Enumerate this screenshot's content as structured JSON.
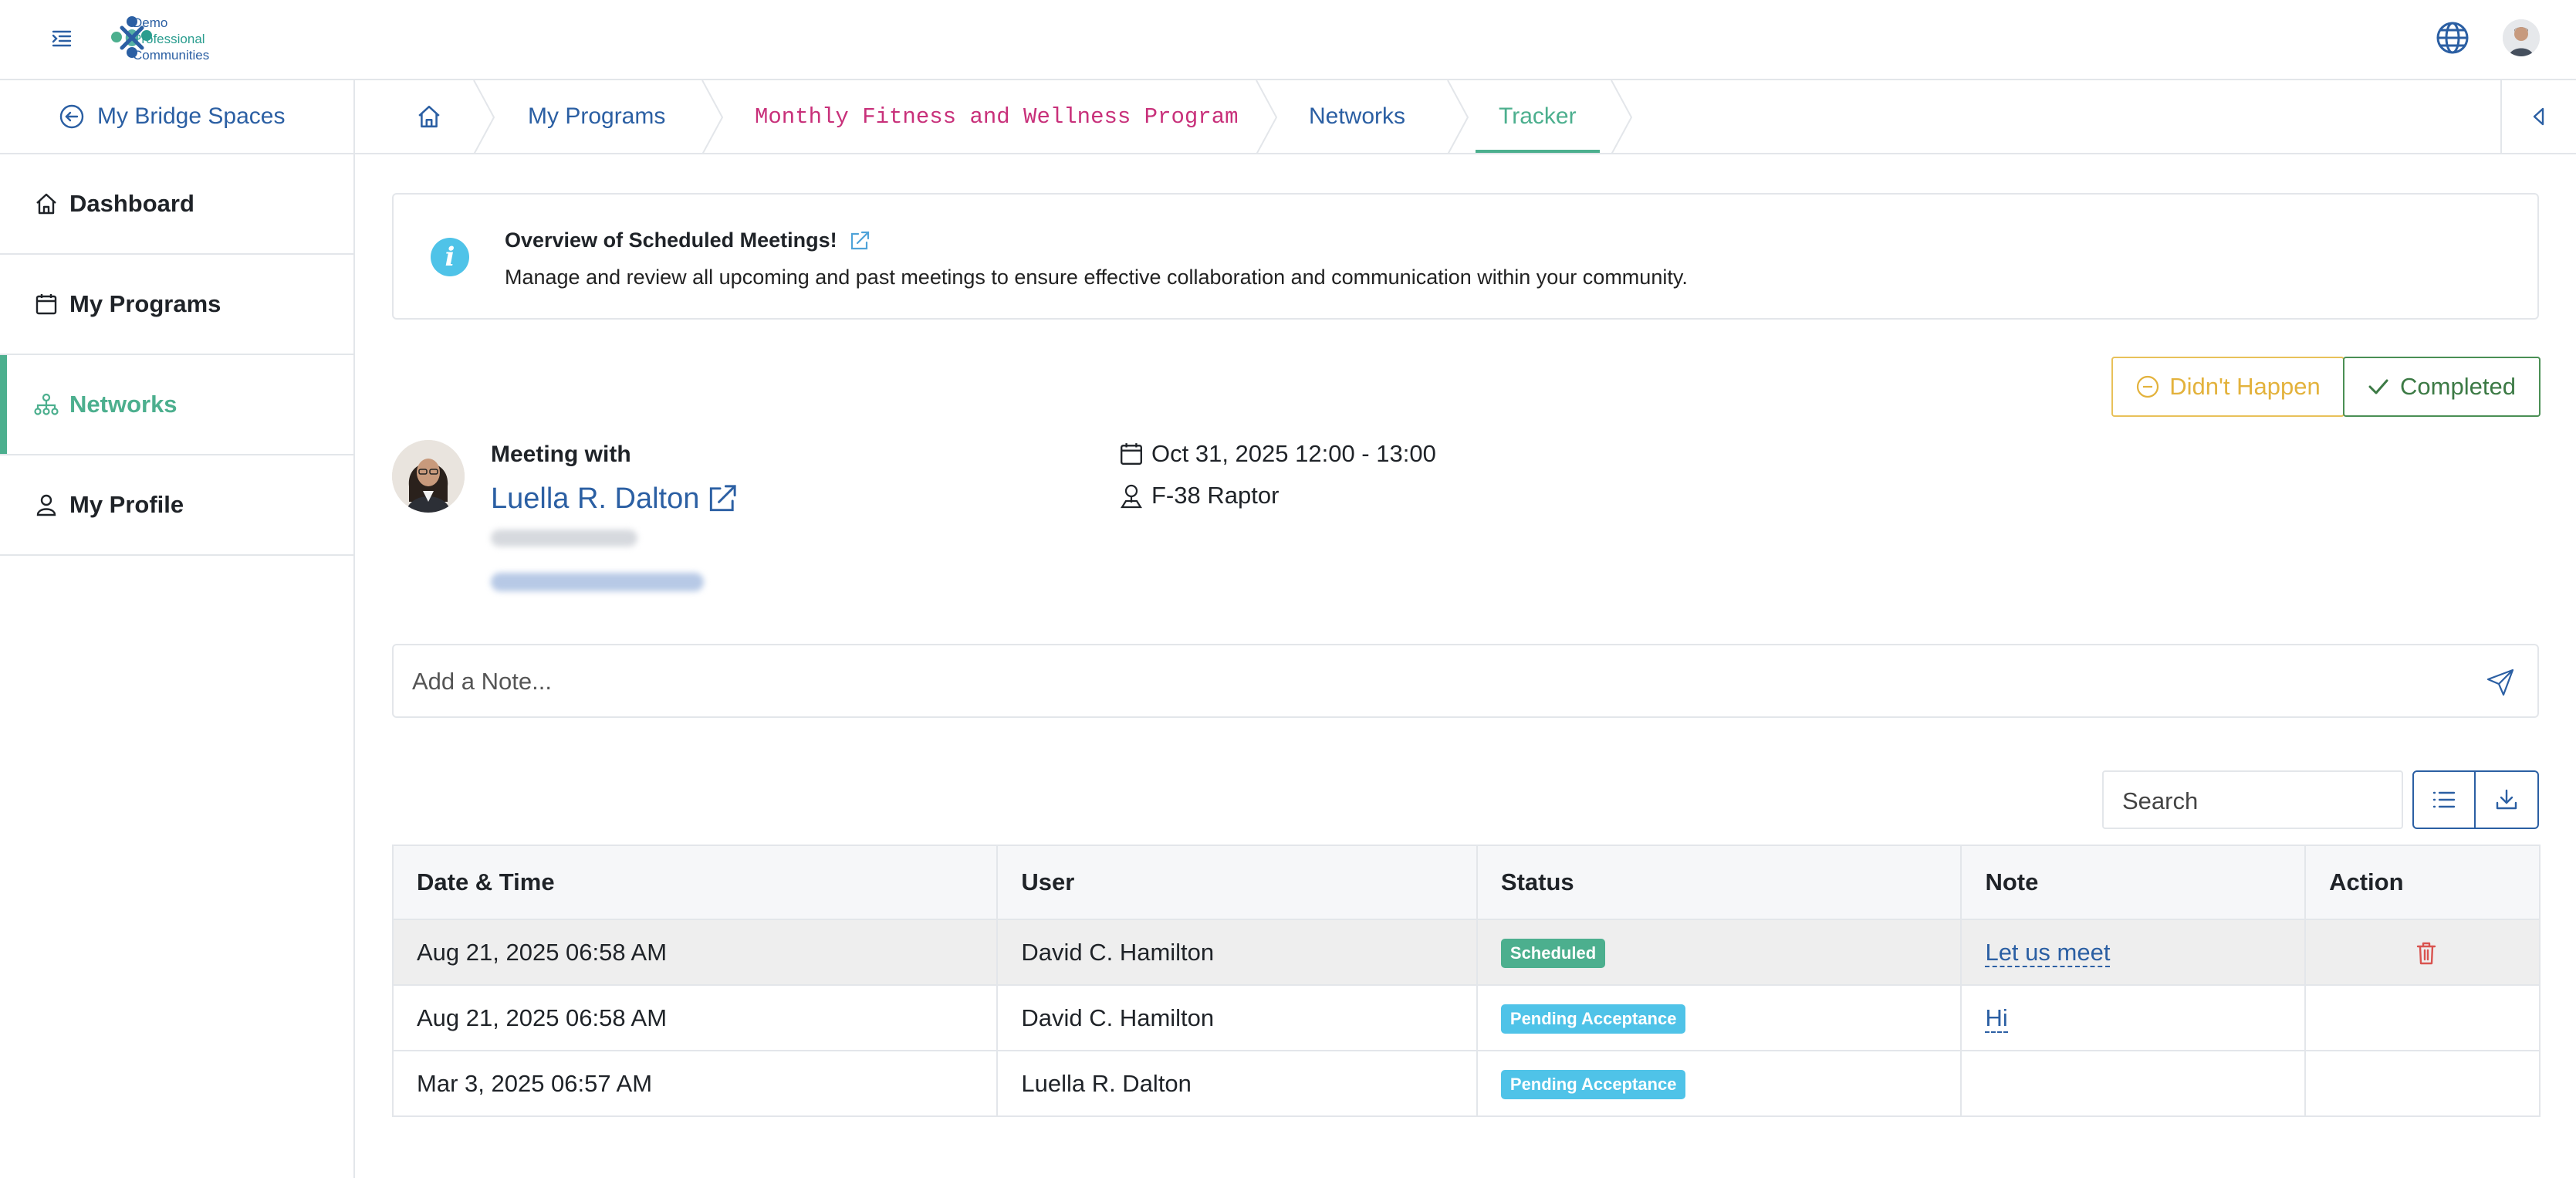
{
  "header": {
    "logo_lines": [
      "Demo",
      "Professional",
      "Communities"
    ],
    "menu_icon": "menu-indent-icon",
    "language_icon": "globe-icon",
    "profile_icon": "user-avatar"
  },
  "sidebar": {
    "back_label": "My Bridge Spaces",
    "items": [
      {
        "label": "Dashboard",
        "icon": "home-icon",
        "active": false
      },
      {
        "label": "My Programs",
        "icon": "calendar-icon",
        "active": false
      },
      {
        "label": "Networks",
        "icon": "network-icon",
        "active": true
      },
      {
        "label": "My Profile",
        "icon": "user-icon",
        "active": false
      }
    ]
  },
  "breadcrumb": {
    "home_icon": "home-icon",
    "items": [
      "My Programs",
      "Monthly Fitness and Wellness Program",
      "Networks",
      "Tracker"
    ],
    "active_index": 3
  },
  "info": {
    "title": "Overview of Scheduled Meetings!",
    "description": "Manage and review all upcoming and past meetings to ensure effective collaboration and communication within your community."
  },
  "actions": {
    "didnt_happen": "Didn't Happen",
    "completed": "Completed"
  },
  "meeting": {
    "label": "Meeting with",
    "name": "Luella R. Dalton",
    "datetime": "Oct 31, 2025 12:00 - 13:00",
    "location": "F-38 Raptor"
  },
  "note": {
    "placeholder": "Add a Note..."
  },
  "search": {
    "placeholder": "Search"
  },
  "table": {
    "columns": [
      "Date & Time",
      "User",
      "Status",
      "Note",
      "Action"
    ],
    "rows": [
      {
        "datetime": "Aug 21, 2025 06:58 AM",
        "user": "David C. Hamilton",
        "status": "Scheduled",
        "note": "Let us meet",
        "action": "delete"
      },
      {
        "datetime": "Aug 21, 2025 06:58 AM",
        "user": "David C. Hamilton",
        "status": "Pending Acceptance",
        "note": "Hi",
        "action": ""
      },
      {
        "datetime": "Mar 3, 2025 06:57 AM",
        "user": "Luella R. Dalton",
        "status": "Pending Acceptance",
        "note": "",
        "action": ""
      }
    ]
  },
  "colors": {
    "primary": "#2b5fa3",
    "accent": "#4caf8e",
    "warning": "#e3b23c",
    "info": "#4fc3e8",
    "danger": "#d9534f"
  }
}
